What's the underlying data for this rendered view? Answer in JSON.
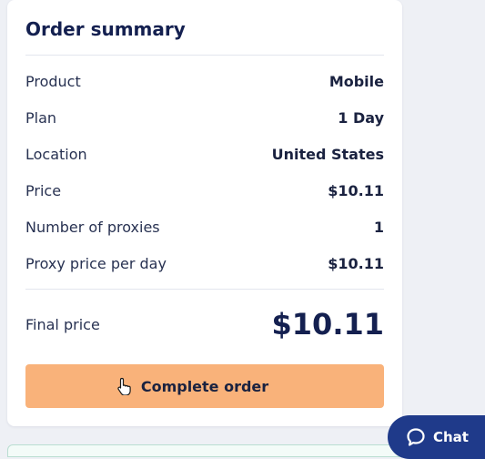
{
  "summary": {
    "title": "Order summary",
    "rows": [
      {
        "label": "Product",
        "value": "Mobile"
      },
      {
        "label": "Plan",
        "value": "1 Day"
      },
      {
        "label": "Location",
        "value": "United States"
      },
      {
        "label": "Price",
        "value": "$10.11"
      },
      {
        "label": "Number of proxies",
        "value": "1"
      },
      {
        "label": "Proxy price per day",
        "value": "$10.11"
      }
    ],
    "final_label": "Final price",
    "final_value": "$10.11"
  },
  "actions": {
    "complete_label": "Complete order"
  },
  "chat": {
    "label": "Chat",
    "icon": "chat-bubble-icon"
  },
  "colors": {
    "accent_button": "#f9b27a",
    "chat_button": "#1f3a8a",
    "title_text": "#142050"
  }
}
